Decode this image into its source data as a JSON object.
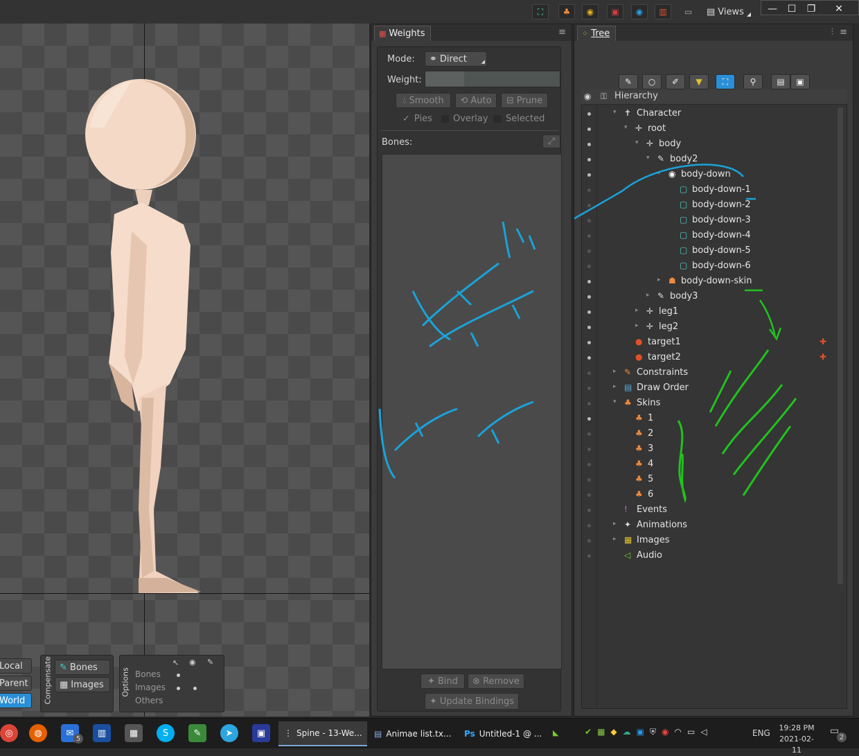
{
  "app": {
    "title": "Spine - 13-We...",
    "views_label": "Views"
  },
  "viewport": {
    "transform_buttons": [
      "Local",
      "Parent",
      "World"
    ],
    "compensate": {
      "label": "Compensate",
      "bones": "Bones",
      "images": "Images"
    },
    "options": {
      "label": "Options",
      "rows": [
        "Bones",
        "Images",
        "Others"
      ]
    }
  },
  "weights": {
    "tab": "Weights",
    "mode_label": "Mode:",
    "mode_value": "Direct",
    "weight_label": "Weight:",
    "smooth": "Smooth",
    "auto": "Auto",
    "prune": "Prune",
    "pies": "Pies",
    "overlay": "Overlay",
    "selected": "Selected",
    "bones_label": "Bones:",
    "bind": "Bind",
    "remove": "Remove",
    "update_bindings": "Update Bindings"
  },
  "tree": {
    "tab": "Tree",
    "header": "Hierarchy",
    "rows": [
      {
        "label": "Character",
        "icon": "character-icon"
      },
      {
        "label": "root",
        "icon": "bone-icon"
      },
      {
        "label": "body",
        "icon": "bone-icon"
      },
      {
        "label": "body2",
        "icon": "bone-brush-icon"
      },
      {
        "label": "body-down",
        "icon": "slot-icon"
      },
      {
        "label": "body-down-1",
        "icon": "attachment-icon"
      },
      {
        "label": "body-down-2",
        "icon": "attachment-icon"
      },
      {
        "label": "body-down-3",
        "icon": "attachment-icon"
      },
      {
        "label": "body-down-4",
        "icon": "attachment-icon"
      },
      {
        "label": "body-down-5",
        "icon": "attachment-icon"
      },
      {
        "label": "body-down-6",
        "icon": "attachment-icon"
      },
      {
        "label": "body-down-skin",
        "icon": "skin-placeholder-icon"
      },
      {
        "label": "body3",
        "icon": "bone-brush-icon"
      },
      {
        "label": "leg1",
        "icon": "bone-icon"
      },
      {
        "label": "leg2",
        "icon": "bone-icon"
      },
      {
        "label": "target1",
        "icon": "target-icon"
      },
      {
        "label": "target2",
        "icon": "target-icon"
      },
      {
        "label": "Constraints",
        "icon": "constraints-icon"
      },
      {
        "label": "Draw Order",
        "icon": "draw-order-icon"
      },
      {
        "label": "Skins",
        "icon": "skins-icon"
      },
      {
        "label": "1",
        "icon": "skin-icon"
      },
      {
        "label": "2",
        "icon": "skin-icon"
      },
      {
        "label": "3",
        "icon": "skin-icon"
      },
      {
        "label": "4",
        "icon": "skin-icon"
      },
      {
        "label": "5",
        "icon": "skin-icon"
      },
      {
        "label": "6",
        "icon": "skin-icon"
      },
      {
        "label": "Events",
        "icon": "events-icon"
      },
      {
        "label": "Animations",
        "icon": "animations-icon"
      },
      {
        "label": "Images",
        "icon": "images-icon"
      },
      {
        "label": "Audio",
        "icon": "audio-icon"
      }
    ]
  },
  "taskbar": {
    "apps": [
      "Spine - 13-We...",
      "Animae list.tx...",
      "Untitled-1 @ ..."
    ],
    "mail_badge": "5",
    "lang": "ENG",
    "time": "19:28 PM",
    "date": "2021-02-11",
    "notif_count": "2"
  },
  "colors": {
    "accent": "#2a8fd6",
    "annotation_blue": "#1aa3d9",
    "annotation_green": "#22c21e",
    "skin": "#f3d9c6"
  }
}
